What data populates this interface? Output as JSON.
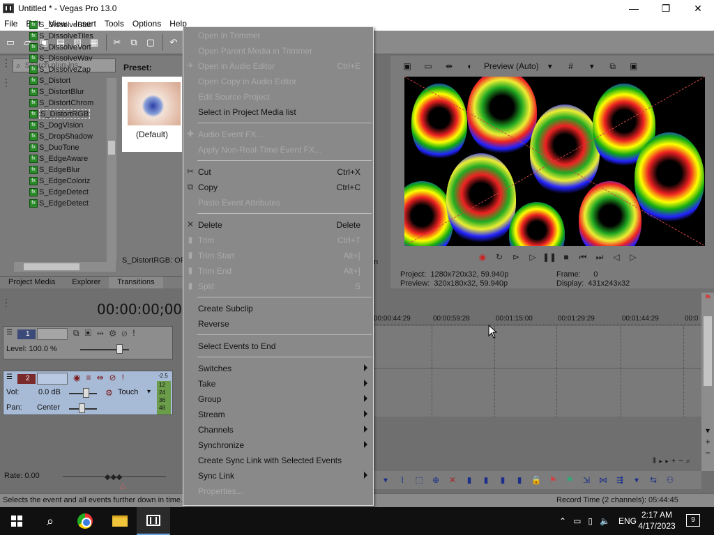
{
  "window": {
    "title": "Untitled * - Vegas Pro 13.0",
    "minimize": "—",
    "maximize": "❐",
    "close": "✕"
  },
  "menubar": [
    "File",
    "Edit",
    "View",
    "Insert",
    "Tools",
    "Options",
    "Help"
  ],
  "plugins": {
    "search_placeholder": "Search plug-ins",
    "items": [
      "S_DissolveStat",
      "S_DissolveTiles",
      "S_DissolveVort",
      "S_DissolveWav",
      "S_DissolveZap",
      "S_Distort",
      "S_DistortBlur",
      "S_DistortChrom",
      "S_DistortRGB",
      "S_DogVision",
      "S_DropShadow",
      "S_DuoTone",
      "S_EdgeAware",
      "S_EdgeBlur",
      "S_EdgeColoriz",
      "S_EdgeDetect",
      "S_EdgeDetect"
    ],
    "selected_index": 8,
    "preset_label": "Preset:",
    "preset_default": "(Default)",
    "status": "S_DistortRGB: OF"
  },
  "panel_tabs": [
    "Project Media",
    "Explorer",
    "Transitions"
  ],
  "preview": {
    "mode": "Preview (Auto)",
    "project_label": "Project:",
    "project_value": "1280x720x32, 59.940p",
    "preview_label": "Preview:",
    "preview_value": "320x180x32, 59.940p",
    "frame_label": "Frame:",
    "frame_value": "0",
    "display_label": "Display:",
    "display_value": "431x243x32",
    "partial_n": "n"
  },
  "timeline": {
    "timecode": "00:00:00;00",
    "ruler": [
      "00:00:44:29",
      "00:00:59:28",
      "00:01:15:00",
      "00:01:29:29",
      "00:01:44:29",
      "00:0"
    ],
    "rate": "Rate: 0.00"
  },
  "tracks": {
    "video": {
      "num": "1",
      "level": "Level: 100.0 %"
    },
    "audio": {
      "num": "2",
      "vol_label": "Vol:",
      "vol_value": "0.0 dB",
      "pan_label": "Pan:",
      "pan_value": "Center",
      "automation": "Touch",
      "meter_top": "-2.5",
      "meter_vals": [
        "12",
        "24",
        "36",
        "48"
      ]
    }
  },
  "context_menu": [
    {
      "label": "Open in Trimmer",
      "shortcut": "",
      "disabled": true,
      "icon": "",
      "submenu": false
    },
    {
      "label": "Open Parent Media in Trimmer",
      "shortcut": "",
      "disabled": true,
      "icon": "",
      "submenu": false
    },
    {
      "label": "Open in Audio Editor",
      "shortcut": "Ctrl+E",
      "disabled": true,
      "icon": "✈",
      "submenu": false
    },
    {
      "label": "Open Copy in Audio Editor",
      "shortcut": "",
      "disabled": true,
      "icon": "",
      "submenu": false
    },
    {
      "label": "Edit Source Project",
      "shortcut": "",
      "disabled": true,
      "icon": "",
      "submenu": false
    },
    {
      "label": "Select in Project Media list",
      "shortcut": "",
      "disabled": false,
      "icon": "",
      "submenu": false
    },
    {
      "label": "Audio Event FX...",
      "shortcut": "",
      "disabled": true,
      "icon": "✚",
      "submenu": false
    },
    {
      "label": "Apply Non-Real-Time Event FX...",
      "shortcut": "",
      "disabled": true,
      "icon": "",
      "submenu": false
    },
    {
      "label": "Cut",
      "shortcut": "Ctrl+X",
      "disabled": false,
      "icon": "✂",
      "submenu": false
    },
    {
      "label": "Copy",
      "shortcut": "Ctrl+C",
      "disabled": false,
      "icon": "⧉",
      "submenu": false
    },
    {
      "label": "Paste Event Attributes",
      "shortcut": "",
      "disabled": true,
      "icon": "",
      "submenu": false
    },
    {
      "label": "Delete",
      "shortcut": "Delete",
      "disabled": false,
      "icon": "✕",
      "submenu": false
    },
    {
      "label": "Trim",
      "shortcut": "Ctrl+T",
      "disabled": true,
      "icon": "▮",
      "submenu": false
    },
    {
      "label": "Trim Start",
      "shortcut": "Alt+[",
      "disabled": true,
      "icon": "▮",
      "submenu": false
    },
    {
      "label": "Trim End",
      "shortcut": "Alt+]",
      "disabled": true,
      "icon": "▮",
      "submenu": false
    },
    {
      "label": "Split",
      "shortcut": "S",
      "disabled": true,
      "icon": "▮",
      "submenu": false
    },
    {
      "label": "Create Subclip",
      "shortcut": "",
      "disabled": false,
      "icon": "",
      "submenu": false
    },
    {
      "label": "Reverse",
      "shortcut": "",
      "disabled": false,
      "icon": "",
      "submenu": false
    },
    {
      "label": "Select Events to End",
      "shortcut": "",
      "disabled": false,
      "icon": "",
      "submenu": false
    },
    {
      "label": "Switches",
      "shortcut": "",
      "disabled": false,
      "icon": "",
      "submenu": true
    },
    {
      "label": "Take",
      "shortcut": "",
      "disabled": false,
      "icon": "",
      "submenu": true
    },
    {
      "label": "Group",
      "shortcut": "",
      "disabled": false,
      "icon": "",
      "submenu": true
    },
    {
      "label": "Stream",
      "shortcut": "",
      "disabled": false,
      "icon": "",
      "submenu": true
    },
    {
      "label": "Channels",
      "shortcut": "",
      "disabled": false,
      "icon": "",
      "submenu": true
    },
    {
      "label": "Synchronize",
      "shortcut": "",
      "disabled": false,
      "icon": "",
      "submenu": true
    },
    {
      "label": "Create Sync Link with Selected Events",
      "shortcut": "",
      "disabled": false,
      "icon": "",
      "submenu": false
    },
    {
      "label": "Sync Link",
      "shortcut": "",
      "disabled": false,
      "icon": "",
      "submenu": true
    },
    {
      "label": "Properties...",
      "shortcut": "",
      "disabled": true,
      "icon": "",
      "submenu": false
    }
  ],
  "status": {
    "text": "Selects the event and all events further down in time.",
    "record_time": "Record Time (2 channels): 05:44:45"
  },
  "taskbar": {
    "time": "2:17 AM",
    "date": "4/17/2023",
    "lang": "ENG",
    "notifications": "9"
  },
  "colors": {
    "menu_bg": "#898989",
    "disabled_text": "#a9a9a9",
    "audio_track": "#a7bad6",
    "accent": "#1a2e8a"
  }
}
